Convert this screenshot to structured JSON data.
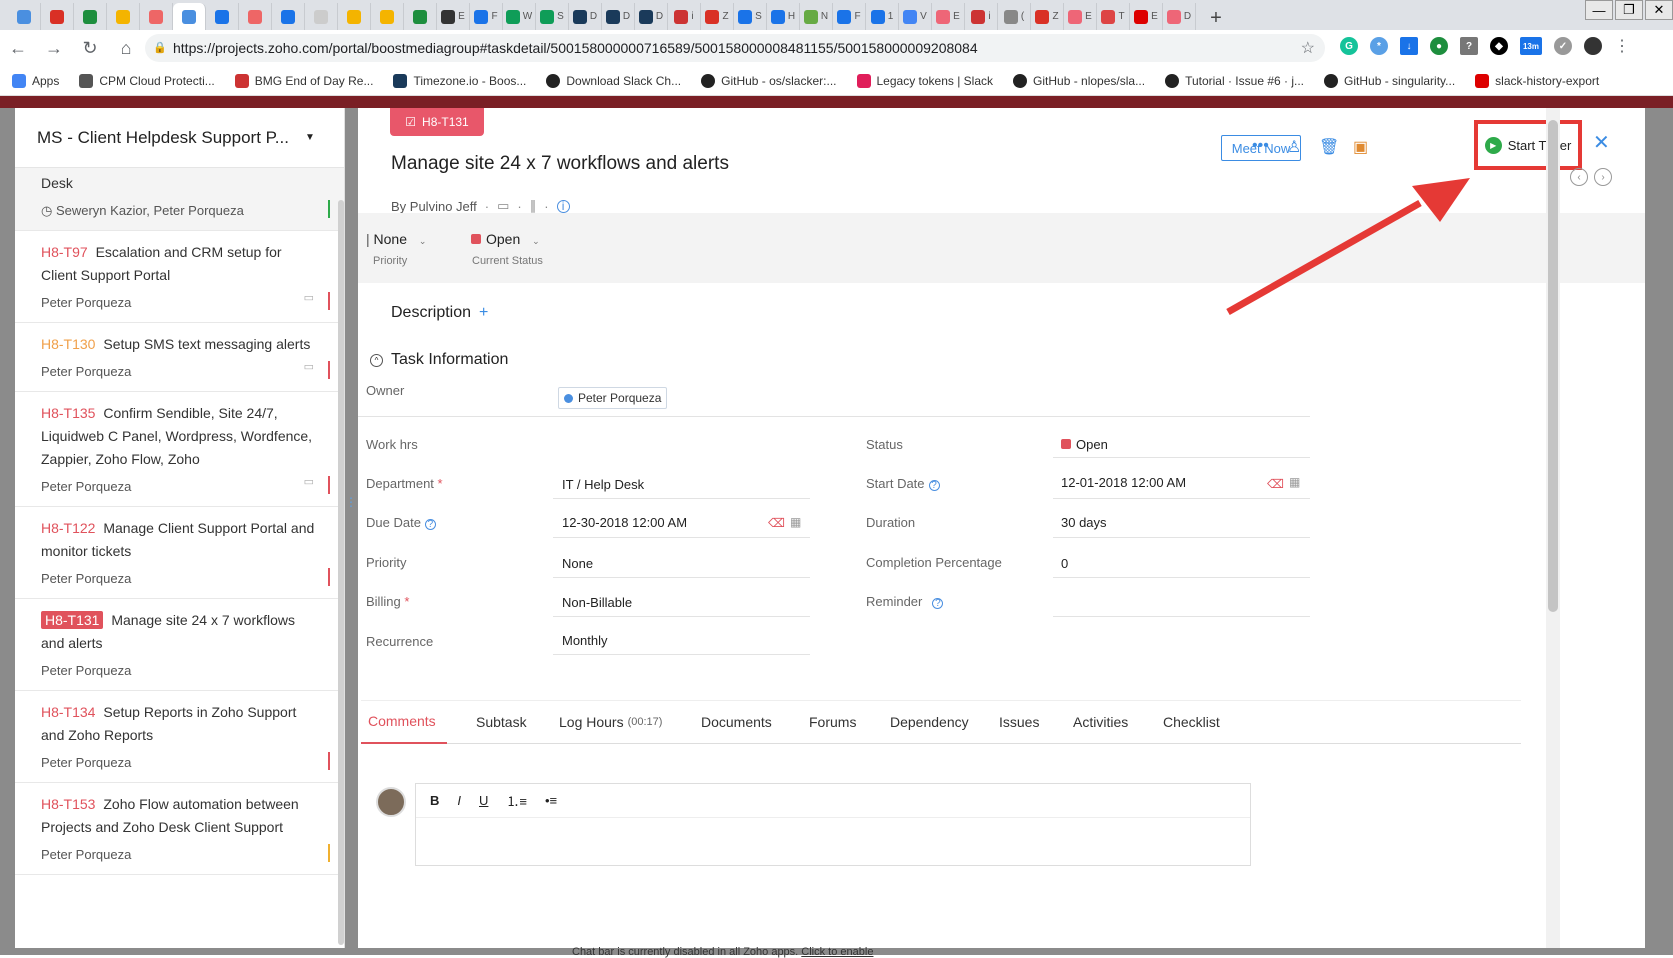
{
  "browser": {
    "tabs": [
      "",
      "",
      "",
      "",
      "",
      "",
      "",
      "",
      "",
      "",
      "",
      "",
      "",
      "",
      "",
      "",
      "",
      "",
      "",
      "",
      "",
      "",
      "",
      "",
      "",
      "",
      "",
      "",
      "",
      "",
      "",
      "",
      "",
      "",
      "",
      "",
      "",
      "",
      "",
      "",
      "",
      ""
    ],
    "tab_chars": [
      "",
      "",
      "",
      "",
      "",
      "",
      "",
      "",
      "",
      "",
      "",
      "",
      "",
      "E",
      "F",
      "W",
      "S",
      "D",
      "D",
      "D",
      "i",
      "Z",
      "S",
      "H",
      "N",
      "F",
      "1",
      "V",
      "E",
      "i",
      "(",
      "Z",
      "E",
      "T",
      "E",
      "D"
    ],
    "url": "https://projects.zoho.com/portal/boostmediagroup#taskdetail/500158000000716589/500158000008481155/500158000009208084",
    "url_host": "projects.zoho.com",
    "ext_badge": "13m",
    "bookmarks": [
      "Apps",
      "CPM Cloud Protecti...",
      "BMG End of Day Re...",
      "Timezone.io - Boos...",
      "Download Slack Ch...",
      "GitHub - os/slacker:...",
      "Legacy tokens | Slack",
      "GitHub - nlopes/sla...",
      "Tutorial · Issue #6 · j...",
      "GitHub - singularity...",
      "slack-history-export"
    ]
  },
  "sidebar": {
    "project": "MS - Client Helpdesk Support P...",
    "items": [
      {
        "code": "",
        "title": "Desk",
        "owner": "Seweryn Kazior, Peter Porqueza",
        "prio_color": "#2eaa4a"
      },
      {
        "code": "H8-T97",
        "title": "Escalation and CRM setup for Client Support Portal",
        "owner": "Peter Porqueza",
        "prio_color": "#e0525c"
      },
      {
        "code": "H8-T130",
        "title": "Setup SMS text messaging alerts",
        "owner": "Peter Porqueza",
        "prio_color": "#e0525c"
      },
      {
        "code": "H8-T135",
        "title": "Confirm Sendible, Site 24/7, Liquidweb C Panel, Wordpress, Wordfence, Zappier, Zoho Flow, Zoho",
        "owner": "Peter Porqueza",
        "prio_color": "#e0525c"
      },
      {
        "code": "H8-T122",
        "title": "Manage Client Support Portal and monitor tickets",
        "owner": "Peter Porqueza",
        "prio_color": "#e0525c"
      },
      {
        "code": "H8-T131",
        "title": "Manage site 24 x 7 workflows and alerts",
        "owner": "Peter Porqueza",
        "prio_color": ""
      },
      {
        "code": "H8-T134",
        "title": "Setup Reports in Zoho Support and Zoho Reports",
        "owner": "Peter Porqueza",
        "prio_color": "#e0525c"
      },
      {
        "code": "H8-T153",
        "title": "Zoho Flow automation between Projects and Zoho Desk Client Support",
        "owner": "Peter Porqueza",
        "prio_color": "#f0b030"
      }
    ]
  },
  "task": {
    "badge": "H8-T131",
    "title": "Manage site 24 x 7 workflows and alerts",
    "byline": "By Pulvino Jeff",
    "meet_now": "Meet Now",
    "start_timer": "Start Timer",
    "priority_value": "None",
    "priority_label": "Priority",
    "status_value": "Open",
    "status_label": "Current Status",
    "description": "Description",
    "section": "Task Information"
  },
  "fields": {
    "owner_label": "Owner",
    "owner": "Peter Porqueza",
    "work_hrs_label": "Work hrs",
    "department_label": "Department",
    "department": "IT / Help Desk",
    "due_label": "Due Date",
    "due": "12-30-2018 12:00 AM",
    "priority_label": "Priority",
    "priority": "None",
    "billing_label": "Billing",
    "billing": "Non-Billable",
    "recurrence_label": "Recurrence",
    "recurrence": "Monthly",
    "status_label": "Status",
    "status": "Open",
    "start_label": "Start Date",
    "start": "12-01-2018 12:00 AM",
    "duration_label": "Duration",
    "duration": "30 days",
    "completion_label": "Completion Percentage",
    "completion": "0",
    "reminder_label": "Reminder"
  },
  "tabs": {
    "comments": "Comments",
    "subtask": "Subtask",
    "log_hours": "Log Hours",
    "log_hours_count": "(00:17)",
    "documents": "Documents",
    "forums": "Forums",
    "dependency": "Dependency",
    "issues": "Issues",
    "activities": "Activities",
    "checklist": "Checklist"
  },
  "editor": {
    "bold": "B",
    "italic": "I",
    "underline": "U"
  },
  "footer": {
    "chat": "Chat bar is currently disabled in all Zoho apps.",
    "enable": "Click to enable"
  },
  "colors": {
    "accent": "#3b8ce3",
    "brand_red": "#e0525c",
    "highlight": "#e53935"
  }
}
